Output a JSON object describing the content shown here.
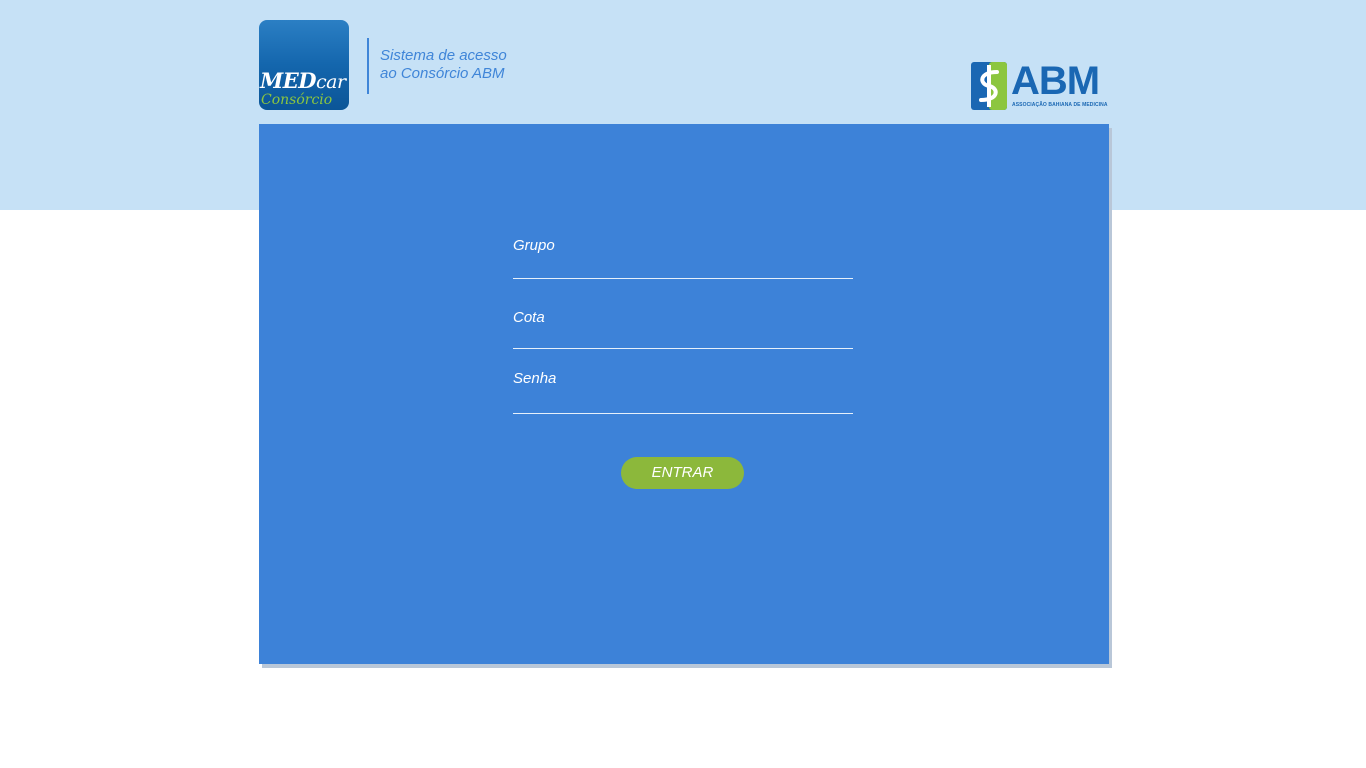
{
  "header": {
    "logo": {
      "line1_bold": "MED",
      "line1_light": "car",
      "line2": "Consórcio"
    },
    "tagline": [
      "Sistema de acesso",
      "ao Consórcio ABM"
    ],
    "partner_logo": {
      "letters": "ABM",
      "subtitle": "ASSOCIAÇÃO BAHIANA DE MEDICINA",
      "icon": "caduceus-icon"
    }
  },
  "login_form": {
    "fields": [
      {
        "label": "Grupo",
        "value": ""
      },
      {
        "label": "Cota",
        "value": ""
      },
      {
        "label": "Senha",
        "value": ""
      }
    ],
    "submit_label": "ENTRAR"
  },
  "colors": {
    "top_band": "#c6e1f6",
    "panel": "#3d82d8",
    "button": "#8cb83b",
    "logo_blue": "#1a67b3",
    "logo_green": "#8cc63f"
  }
}
